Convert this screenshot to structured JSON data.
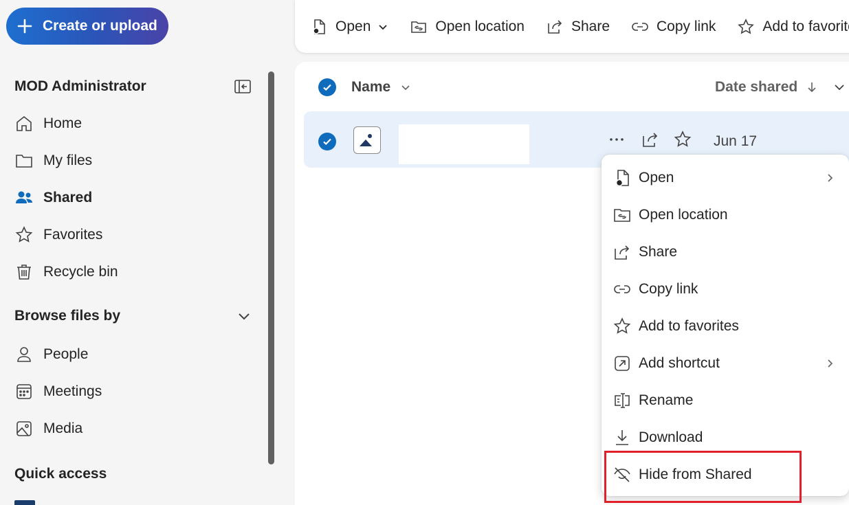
{
  "create_button": {
    "label": "Create or upload",
    "icon": "plus-icon"
  },
  "sidebar": {
    "user": "MOD Administrator",
    "nav": [
      {
        "label": "Home",
        "icon": "home-icon"
      },
      {
        "label": "My files",
        "icon": "folder-icon"
      },
      {
        "label": "Shared",
        "icon": "people-icon",
        "active": true
      },
      {
        "label": "Favorites",
        "icon": "star-icon"
      },
      {
        "label": "Recycle bin",
        "icon": "trash-icon"
      }
    ],
    "browse_heading": "Browse files by",
    "browse": [
      {
        "label": "People",
        "icon": "person-icon"
      },
      {
        "label": "Meetings",
        "icon": "calendar-icon"
      },
      {
        "label": "Media",
        "icon": "image-icon"
      }
    ],
    "quick_access": "Quick access"
  },
  "toolbar": {
    "items": [
      {
        "label": "Open",
        "icon": "open-file-icon"
      },
      {
        "label": "Open location",
        "icon": "folder-link-icon"
      },
      {
        "label": "Share",
        "icon": "share-icon"
      },
      {
        "label": "Copy link",
        "icon": "link-icon"
      },
      {
        "label": "Add to favorites",
        "icon": "star-icon"
      }
    ]
  },
  "list": {
    "col_name": "Name",
    "col_date": "Date shared",
    "rows": [
      {
        "name": "",
        "date": "Jun 17",
        "icon": "image-file-icon",
        "selected": true
      }
    ]
  },
  "context_menu": {
    "items": [
      {
        "label": "Open",
        "icon": "open-file-icon",
        "submenu": true
      },
      {
        "label": "Open location",
        "icon": "folder-link-icon"
      },
      {
        "label": "Share",
        "icon": "share-icon"
      },
      {
        "label": "Copy link",
        "icon": "link-icon"
      },
      {
        "label": "Add to favorites",
        "icon": "star-icon"
      },
      {
        "label": "Add shortcut",
        "icon": "shortcut-icon",
        "submenu": true
      },
      {
        "label": "Rename",
        "icon": "rename-icon"
      },
      {
        "label": "Download",
        "icon": "download-icon"
      },
      {
        "label": "Hide from Shared",
        "icon": "eye-off-icon",
        "highlighted": true
      }
    ]
  },
  "colors": {
    "accent": "#0f6cbd",
    "selection": "#e8f1fb",
    "highlight_border": "#e0202b"
  }
}
